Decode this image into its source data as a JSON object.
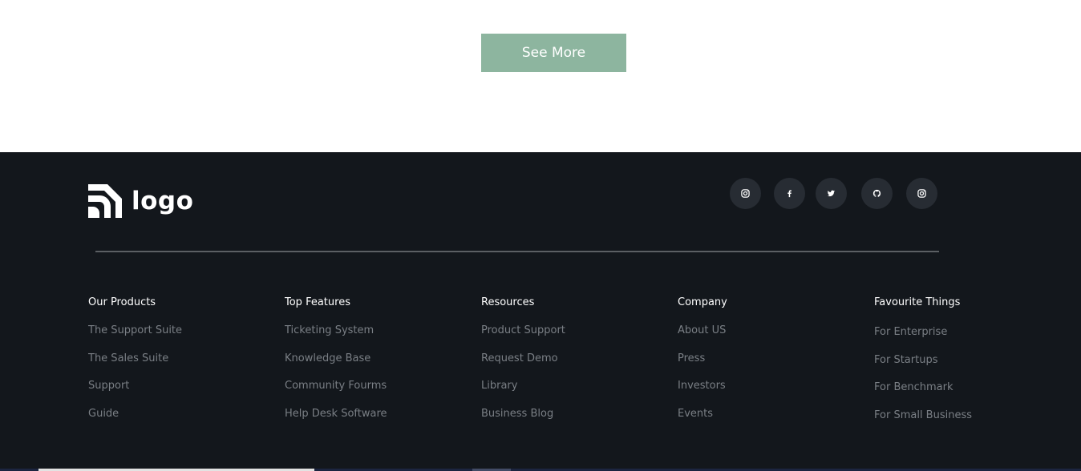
{
  "cta": {
    "label": "See More"
  },
  "footer": {
    "logo_text": "logo",
    "socials": [
      {
        "icon": "instagram-icon"
      },
      {
        "icon": "facebook-icon"
      },
      {
        "icon": "twitter-icon"
      },
      {
        "icon": "github-icon"
      },
      {
        "icon": "instagram-icon"
      }
    ],
    "columns": [
      {
        "title": "Our Products",
        "items": [
          "The Support Suite",
          "The Sales Suite",
          "Support",
          "Guide"
        ]
      },
      {
        "title": "Top Features",
        "items": [
          "Ticketing System",
          "Knowledge Base",
          "Community Fourms",
          "Help Desk Software"
        ]
      },
      {
        "title": "Resources",
        "items": [
          "Product Support",
          "Request Demo",
          "Library",
          "Business Blog"
        ]
      },
      {
        "title": "Company",
        "items": [
          "About US",
          "Press",
          "Investors",
          "Events"
        ]
      },
      {
        "title": "Favourite Things",
        "items": [
          "For Enterprise",
          "For Startups",
          "For Benchmark",
          "For Small Business"
        ]
      }
    ]
  },
  "colors": {
    "accent": "#8db59f",
    "footer_bg": "#13171c",
    "social_bg": "#272c33",
    "link": "#7a7f85"
  }
}
